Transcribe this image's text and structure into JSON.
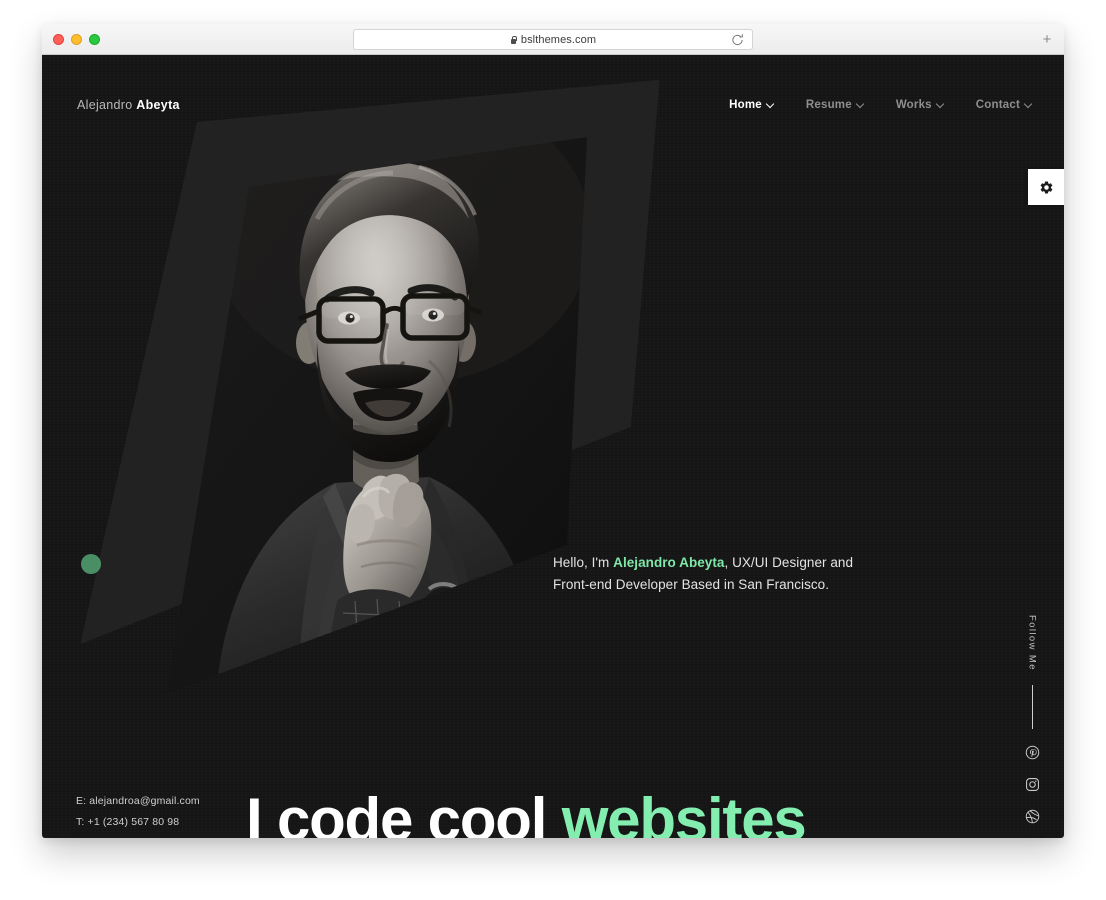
{
  "browser": {
    "url": "bslthemes.com",
    "lock_icon": "lock-icon",
    "reload_icon": "reload-icon",
    "new_tab_label": "+",
    "traffic_lights": [
      "close",
      "minimize",
      "maximize"
    ]
  },
  "header": {
    "logo_first": "Alejandro",
    "logo_last": "Abeyta",
    "nav": [
      {
        "label": "Home",
        "active": true,
        "icon": "chevron-down-icon"
      },
      {
        "label": "Resume",
        "active": false,
        "icon": "chevron-down-icon"
      },
      {
        "label": "Works",
        "active": false,
        "icon": "chevron-down-icon"
      },
      {
        "label": "Contact",
        "active": false,
        "icon": "chevron-down-icon"
      }
    ],
    "settings_icon": "gear-icon"
  },
  "hero": {
    "intro_prefix": "Hello, I'm ",
    "intro_name": "Alejandro Abeyta",
    "intro_suffix": ", UX/UI Designer and Front-end Developer Based in San Francisco.",
    "headline_white": "I code cool",
    "headline_green": "websites",
    "portrait_alt": "portrait-photo"
  },
  "contact": {
    "email_line": "E: alejandroa@gmail.com",
    "phone_line": "T: +1 (234) 567 80 98"
  },
  "follow": {
    "label": "Follow Me",
    "socials": [
      {
        "name": "pinterest-icon"
      },
      {
        "name": "instagram-icon"
      },
      {
        "name": "dribbble-icon"
      }
    ]
  },
  "colors": {
    "accent_green": "#84eeb0",
    "accent_green_soft": "#7fe7a8",
    "page_bg": "#151515",
    "shape_bg": "#222222",
    "deco_dot": "#5ebd83"
  }
}
